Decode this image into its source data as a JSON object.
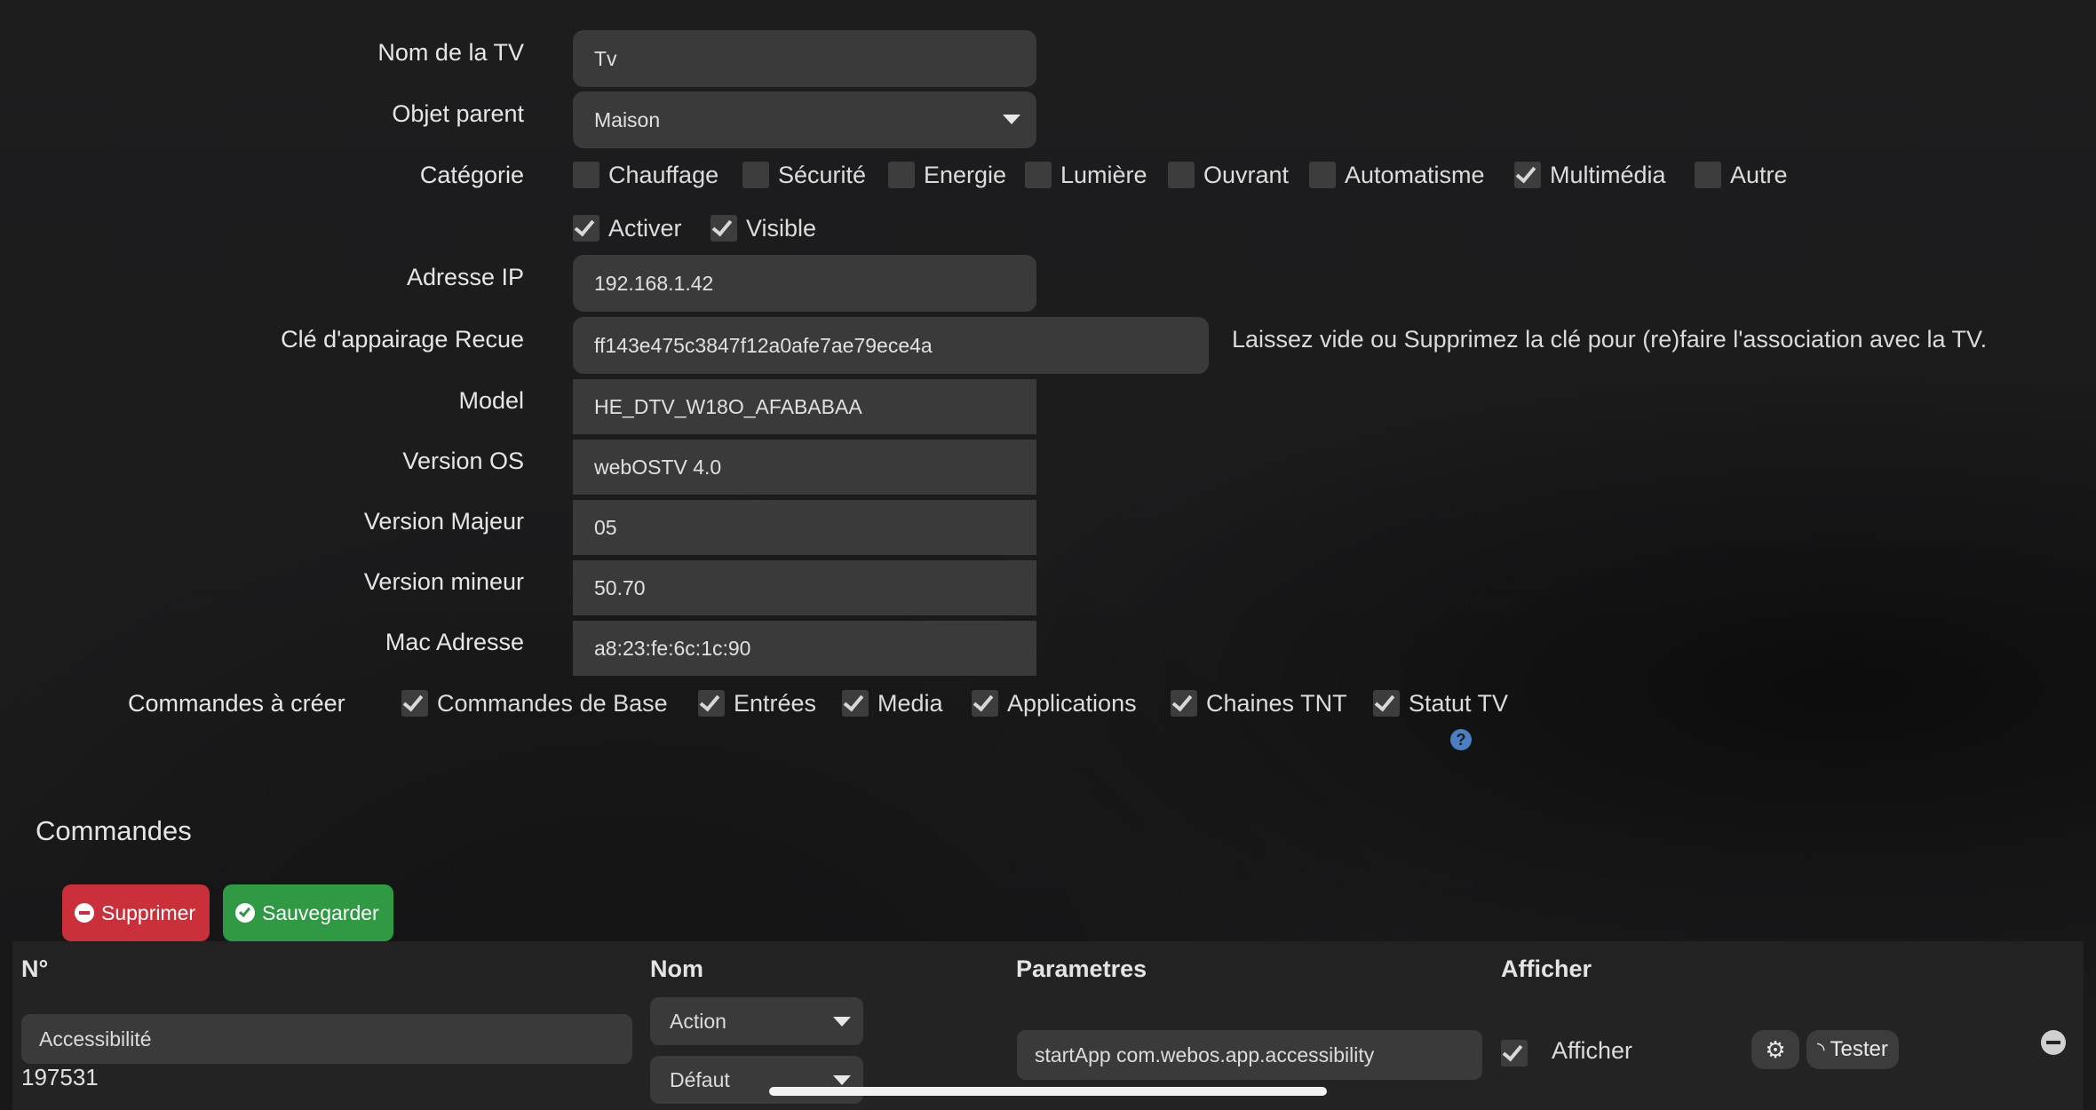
{
  "form": {
    "name_label": "Nom de la TV",
    "name_value": "Tv",
    "parent_label": "Objet parent",
    "parent_value": "Maison",
    "category_label": "Catégorie",
    "categories": [
      {
        "label": "Chauffage",
        "checked": false
      },
      {
        "label": "Sécurité",
        "checked": false
      },
      {
        "label": "Energie",
        "checked": false
      },
      {
        "label": "Lumière",
        "checked": false
      },
      {
        "label": "Ouvrant",
        "checked": false
      },
      {
        "label": "Automatisme",
        "checked": false
      },
      {
        "label": "Multimédia",
        "checked": true
      },
      {
        "label": "Autre",
        "checked": false
      }
    ],
    "activate_label": "Activer",
    "visible_label": "Visible",
    "ip_label": "Adresse IP",
    "ip_value": "192.168.1.42",
    "key_label": "Clé d'appairage Recue",
    "key_value": "ff143e475c3847f12a0afe7ae79ece4a",
    "key_hint": "Laissez vide ou Supprimez la clé pour (re)faire l'association avec la TV.",
    "model_label": "Model",
    "model_value": "HE_DTV_W18O_AFABABAA",
    "os_label": "Version OS",
    "os_value": "webOSTV 4.0",
    "major_label": "Version Majeur",
    "major_value": "05",
    "minor_label": "Version mineur",
    "minor_value": "50.70",
    "mac_label": "Mac Adresse",
    "mac_value": "a8:23:fe:6c:1c:90",
    "commands_create_label": "Commandes à créer",
    "commands_create": [
      {
        "label": "Commandes de Base",
        "checked": true
      },
      {
        "label": "Entrées",
        "checked": true
      },
      {
        "label": "Media",
        "checked": true
      },
      {
        "label": "Applications",
        "checked": true
      },
      {
        "label": "Chaines TNT",
        "checked": true
      },
      {
        "label": "Statut TV",
        "checked": true
      }
    ]
  },
  "commands": {
    "title": "Commandes",
    "delete_label": "Supprimer",
    "save_label": "Sauvegarder",
    "colors": {
      "delete": "#c9303a",
      "save": "#2f9944"
    },
    "headers": {
      "id": "N°",
      "name": "Nom",
      "params": "Parametres",
      "show": "Afficher"
    },
    "rows": [
      {
        "name": "Accessibilité",
        "id": "197531",
        "type": "Action",
        "subtype": "Défaut",
        "param": "startApp com.webos.app.accessibility",
        "show_label": "Afficher",
        "show_checked": true,
        "test_label": "Tester"
      }
    ]
  }
}
